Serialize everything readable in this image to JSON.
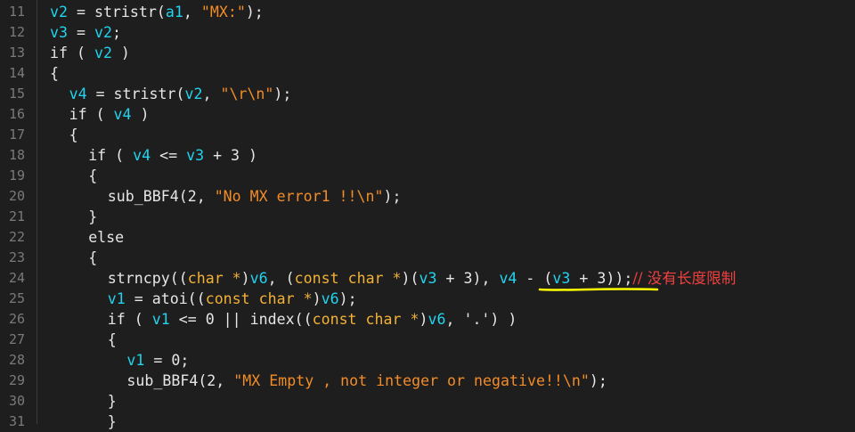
{
  "colors": {
    "background": "#1e1e1e",
    "variable": "#22d3ee",
    "string": "#f28c28",
    "type": "#f2b137",
    "comment": "#f04040",
    "annotation": "#ffff00"
  },
  "lines": [
    {
      "n": "11",
      "indent": 0,
      "tokens": [
        {
          "t": "v2",
          "c": "var"
        },
        {
          "t": " = stristr("
        },
        {
          "t": "a1",
          "c": "var"
        },
        {
          "t": ", "
        },
        {
          "t": "\"MX:\"",
          "c": "str"
        },
        {
          "t": ");"
        }
      ]
    },
    {
      "n": "12",
      "indent": 0,
      "tokens": [
        {
          "t": "v3",
          "c": "var"
        },
        {
          "t": " = "
        },
        {
          "t": "v2",
          "c": "var"
        },
        {
          "t": ";"
        }
      ]
    },
    {
      "n": "13",
      "indent": 0,
      "tokens": [
        {
          "t": "if ( "
        },
        {
          "t": "v2",
          "c": "var"
        },
        {
          "t": " )"
        }
      ]
    },
    {
      "n": "14",
      "indent": 0,
      "tokens": [
        {
          "t": "{"
        }
      ]
    },
    {
      "n": "15",
      "indent": 1,
      "tokens": [
        {
          "t": "v4",
          "c": "var"
        },
        {
          "t": " = stristr("
        },
        {
          "t": "v2",
          "c": "var"
        },
        {
          "t": ", "
        },
        {
          "t": "\"\\r\\n\"",
          "c": "str"
        },
        {
          "t": ");"
        }
      ]
    },
    {
      "n": "16",
      "indent": 1,
      "tokens": [
        {
          "t": "if ( "
        },
        {
          "t": "v4",
          "c": "var"
        },
        {
          "t": " )"
        }
      ]
    },
    {
      "n": "17",
      "indent": 1,
      "tokens": [
        {
          "t": "{"
        }
      ]
    },
    {
      "n": "18",
      "indent": 2,
      "tokens": [
        {
          "t": "if ( "
        },
        {
          "t": "v4",
          "c": "var"
        },
        {
          "t": " <= "
        },
        {
          "t": "v3",
          "c": "var"
        },
        {
          "t": " + 3 )"
        }
      ]
    },
    {
      "n": "19",
      "indent": 2,
      "tokens": [
        {
          "t": "{"
        }
      ]
    },
    {
      "n": "20",
      "indent": 3,
      "tokens": [
        {
          "t": "sub_BBF4(2, "
        },
        {
          "t": "\"No MX error1 !!\\n\"",
          "c": "str"
        },
        {
          "t": ");"
        }
      ]
    },
    {
      "n": "21",
      "indent": 2,
      "tokens": [
        {
          "t": "}"
        }
      ]
    },
    {
      "n": "22",
      "indent": 2,
      "tokens": [
        {
          "t": "else"
        }
      ]
    },
    {
      "n": "23",
      "indent": 2,
      "tokens": [
        {
          "t": "{"
        }
      ]
    },
    {
      "n": "24",
      "indent": 3,
      "tokens": [
        {
          "t": "strncpy(("
        },
        {
          "t": "char *",
          "c": "type"
        },
        {
          "t": ")"
        },
        {
          "t": "v6",
          "c": "var"
        },
        {
          "t": ", ("
        },
        {
          "t": "const char *",
          "c": "type"
        },
        {
          "t": ")("
        },
        {
          "t": "v3",
          "c": "var"
        },
        {
          "t": " + 3), "
        },
        {
          "t": "v4",
          "c": "var"
        },
        {
          "t": " - ("
        },
        {
          "t": "v3",
          "c": "var"
        },
        {
          "t": " + 3));"
        },
        {
          "t": "// 没有长度限制",
          "c": "cmt"
        }
      ]
    },
    {
      "n": "25",
      "indent": 3,
      "tokens": [
        {
          "t": "v1",
          "c": "var"
        },
        {
          "t": " = atoi(("
        },
        {
          "t": "const char *",
          "c": "type"
        },
        {
          "t": ")"
        },
        {
          "t": "v6",
          "c": "var"
        },
        {
          "t": ");"
        }
      ]
    },
    {
      "n": "26",
      "indent": 3,
      "tokens": [
        {
          "t": "if ( "
        },
        {
          "t": "v1",
          "c": "var"
        },
        {
          "t": " <= 0 || index(("
        },
        {
          "t": "const char *",
          "c": "type"
        },
        {
          "t": ")"
        },
        {
          "t": "v6",
          "c": "var"
        },
        {
          "t": ", '.') )"
        }
      ]
    },
    {
      "n": "27",
      "indent": 3,
      "tokens": [
        {
          "t": "{"
        }
      ]
    },
    {
      "n": "28",
      "indent": 4,
      "tokens": [
        {
          "t": "v1",
          "c": "var"
        },
        {
          "t": " = 0;"
        }
      ]
    },
    {
      "n": "29",
      "indent": 4,
      "tokens": [
        {
          "t": "sub_BBF4(2, "
        },
        {
          "t": "\"MX Empty , not integer or negative!!\\n\"",
          "c": "str"
        },
        {
          "t": ");"
        }
      ]
    },
    {
      "n": "30",
      "indent": 3,
      "tokens": [
        {
          "t": "}"
        }
      ]
    },
    {
      "n": "31",
      "indent": 3,
      "tokens": [
        {
          "t": "}"
        }
      ]
    }
  ]
}
